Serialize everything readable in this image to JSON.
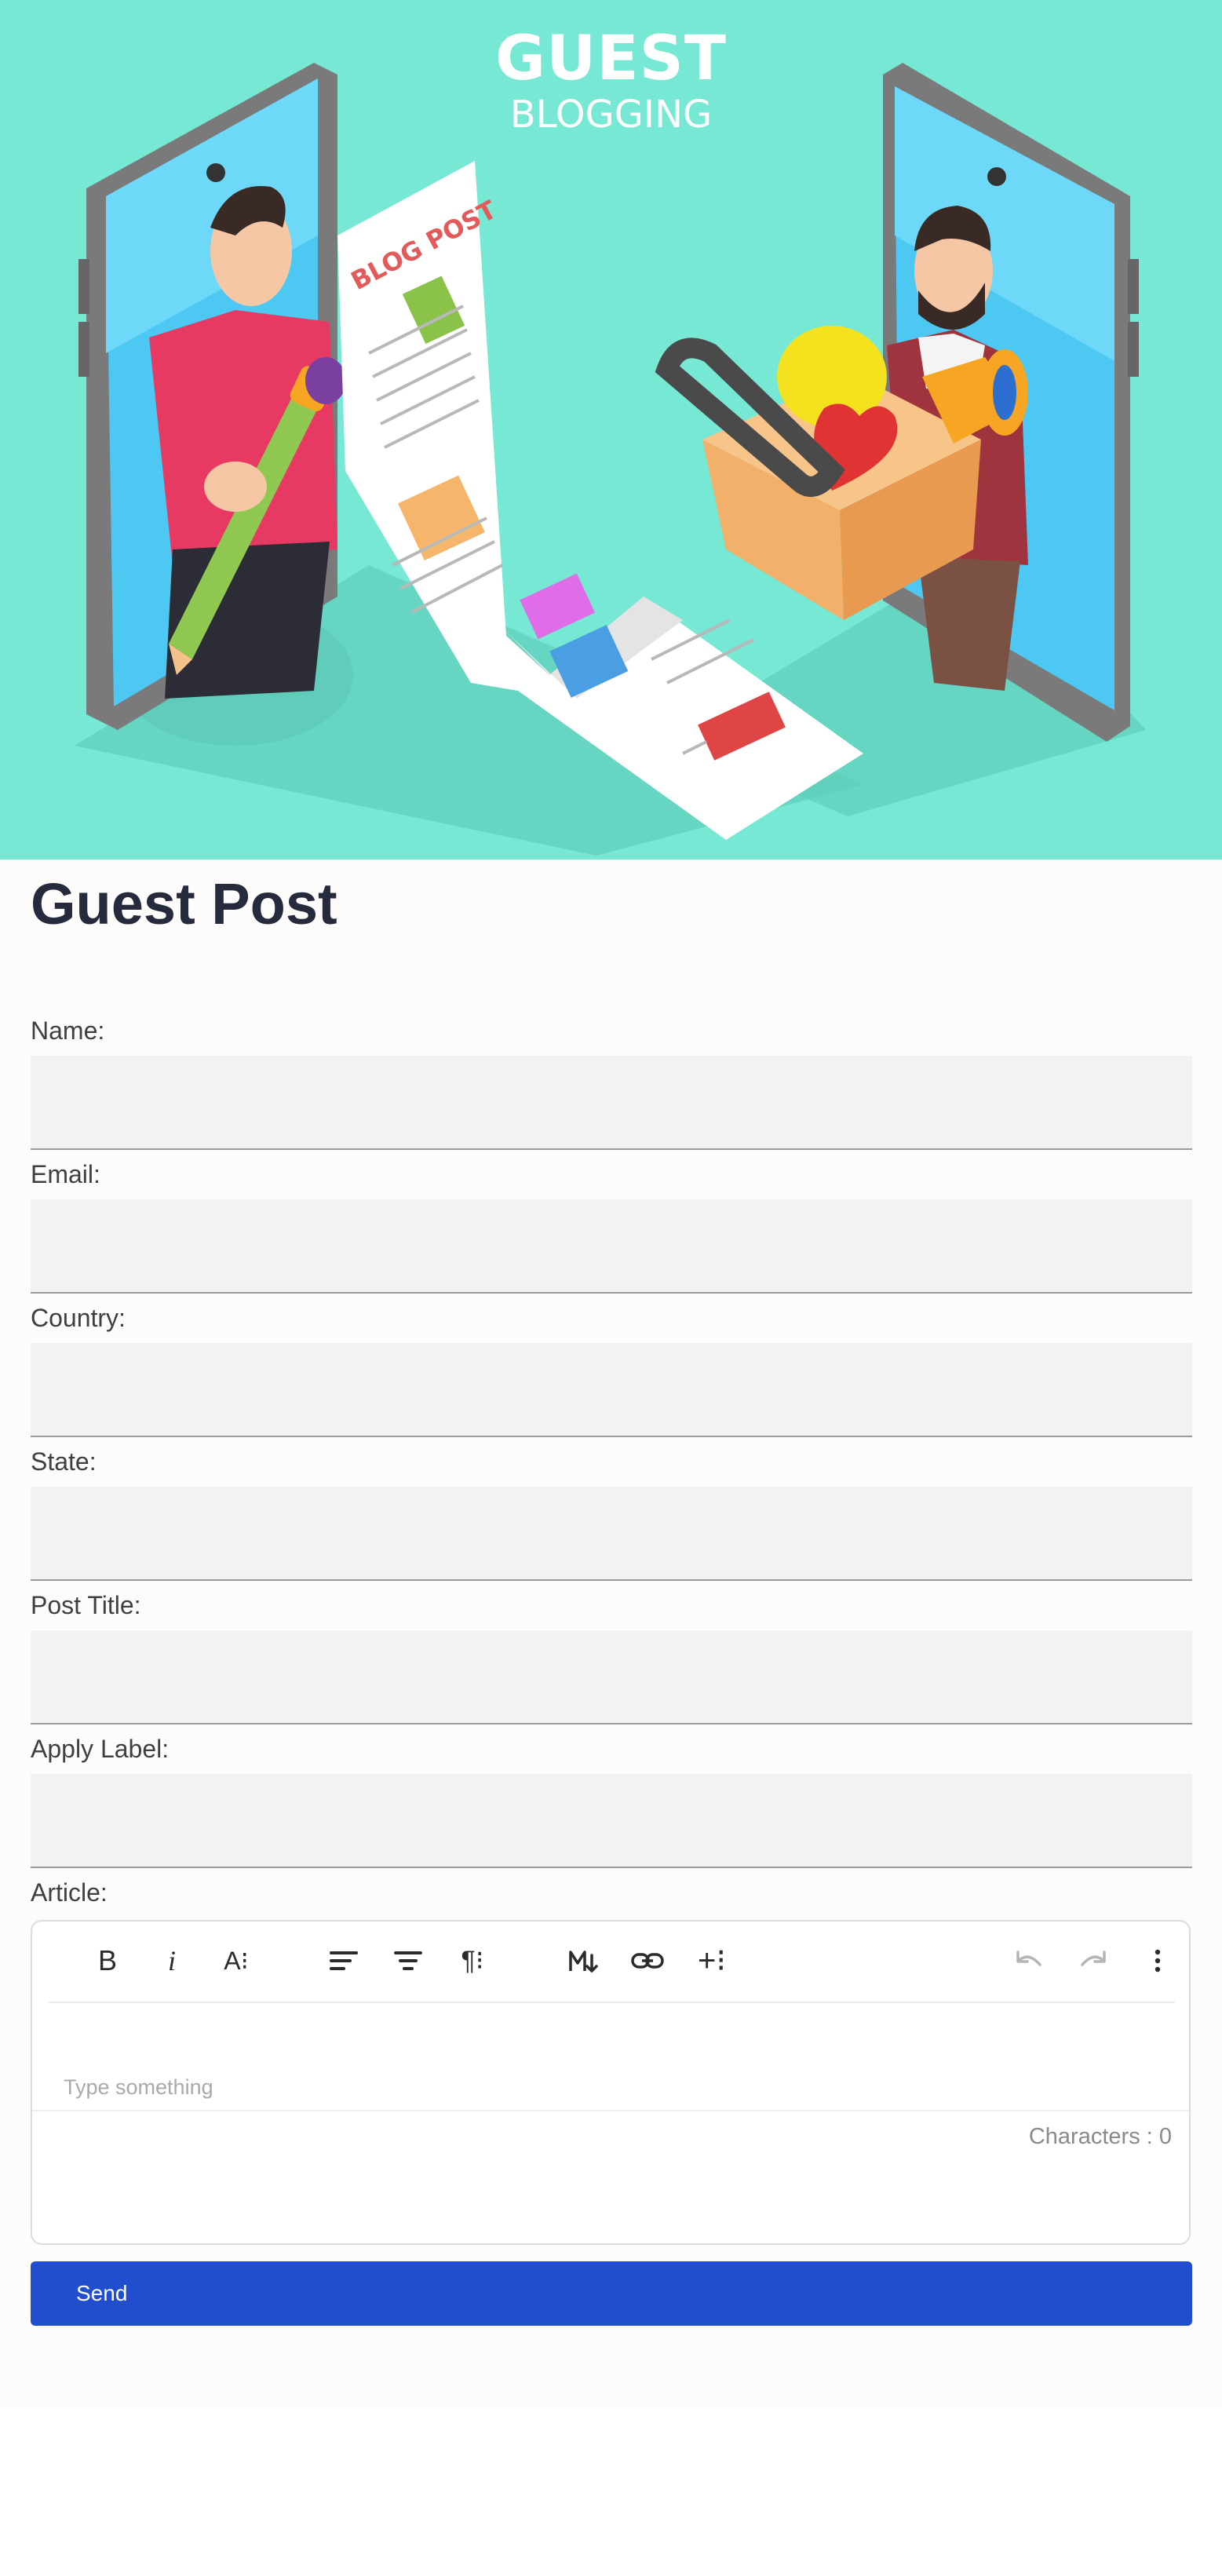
{
  "hero": {
    "title": "GUEST",
    "subtitle": "BLOGGING",
    "colors": {
      "background": "#76e8d3"
    }
  },
  "form": {
    "title": "Guest Post",
    "fields": [
      {
        "label": "Name:",
        "value": ""
      },
      {
        "label": "Email:",
        "value": ""
      },
      {
        "label": "Country:",
        "value": ""
      },
      {
        "label": "State:",
        "value": ""
      },
      {
        "label": "Post Title:",
        "value": ""
      },
      {
        "label": "Apply Label:",
        "value": ""
      }
    ],
    "article_label": "Article:",
    "editor": {
      "toolbar": {
        "bold": "B",
        "italic": "i",
        "font_size": "A⁝",
        "paragraph": "¶⁝",
        "insert": "+⁝",
        "icons": [
          "bold-icon",
          "italic-icon",
          "font-size-icon",
          "align-left-icon",
          "align-center-icon",
          "paragraph-icon",
          "markdown-icon",
          "link-icon",
          "insert-icon",
          "undo-icon",
          "redo-icon",
          "more-icon"
        ]
      },
      "placeholder": "Type something",
      "char_count": "Characters : 0"
    },
    "send_label": "Send",
    "colors": {
      "send_button": "#214ecf",
      "title": "#252a3d",
      "input_bg": "#f2f2f2"
    }
  }
}
